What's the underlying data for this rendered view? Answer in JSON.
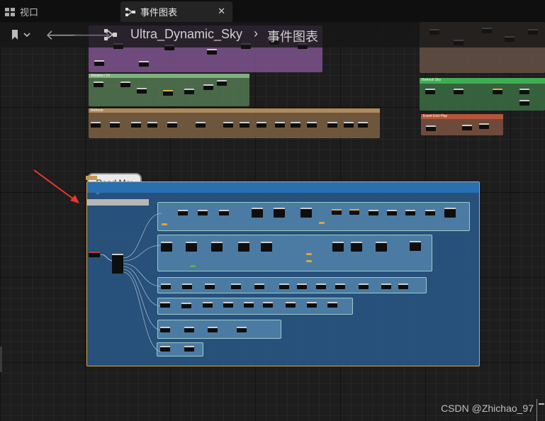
{
  "tabs": [
    {
      "label": "视口",
      "icon": "viewport-grid-icon"
    },
    {
      "label": "事件图表",
      "icon": "event-graph-icon",
      "close": "✕"
    }
  ],
  "toolbar": {
    "back_glyph": "🡐",
    "forward_glyph": "🡒",
    "breadcrumb": [
      "Ultra_Dynamic_Sky",
      "事件图表"
    ],
    "separator": "›"
  },
  "canvas": {
    "comments": [
      {
        "id": "purple",
        "label": "",
        "color": "#8a5a9e"
      },
      {
        "id": "green-1",
        "label": "Window / UI",
        "color": "#5d8a5d"
      },
      {
        "id": "orange-1",
        "label": "Refresh",
        "color": "#8a6a48"
      },
      {
        "id": "topright",
        "label": "",
        "color": "#6a5548"
      },
      {
        "id": "refresh-sky",
        "label": "Refresh Sky",
        "color": "#3fae52"
      },
      {
        "id": "event-end-play",
        "label": "Event End Play",
        "color": "#b5553a"
      },
      {
        "id": "blue-main",
        "label": "",
        "color": "#2a6fb0"
      }
    ],
    "readme_label": "Read Me:"
  },
  "watermark": "CSDN @Zhichao_97",
  "colors": {
    "accent_arrow": "#e8372c",
    "graph_bg": "#1d1d1d"
  }
}
